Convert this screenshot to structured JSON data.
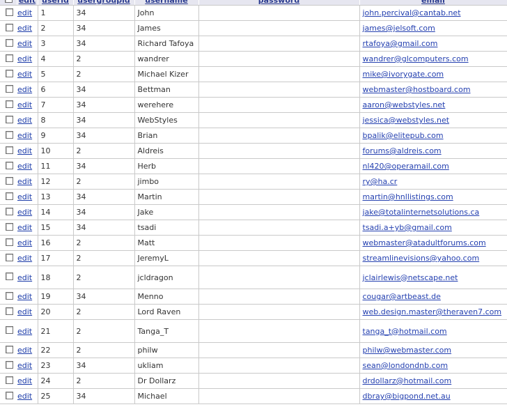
{
  "table": {
    "columns": {
      "edit": "edit",
      "userid": "userid",
      "usergroupid": "usergroupid",
      "username": "username",
      "password": "password",
      "email": "email"
    },
    "rows": [
      {
        "edit": "edit",
        "userid": "1",
        "usergroupid": "34",
        "username": "John",
        "password": "",
        "email": "john.percival@cantab.net"
      },
      {
        "edit": "edit",
        "userid": "2",
        "usergroupid": "34",
        "username": "James",
        "password": "",
        "email": "james@jelsoft.com"
      },
      {
        "edit": "edit",
        "userid": "3",
        "usergroupid": "34",
        "username": "Richard Tafoya",
        "password": "",
        "email": "rtafoya@gmail.com"
      },
      {
        "edit": "edit",
        "userid": "4",
        "usergroupid": "2",
        "username": "wandrer",
        "password": "",
        "email": "wandrer@glcomputers.com"
      },
      {
        "edit": "edit",
        "userid": "5",
        "usergroupid": "2",
        "username": "Michael Kizer",
        "password": "",
        "email": "mike@ivorygate.com"
      },
      {
        "edit": "edit",
        "userid": "6",
        "usergroupid": "34",
        "username": "Bettman",
        "password": "",
        "email": "webmaster@hostboard.com"
      },
      {
        "edit": "edit",
        "userid": "7",
        "usergroupid": "34",
        "username": "werehere",
        "password": "",
        "email": "aaron@webstyles.net"
      },
      {
        "edit": "edit",
        "userid": "8",
        "usergroupid": "34",
        "username": "WebStyles",
        "password": "",
        "email": "jessica@webstyles.net"
      },
      {
        "edit": "edit",
        "userid": "9",
        "usergroupid": "34",
        "username": "Brian",
        "password": "",
        "email": "bpalik@elitepub.com"
      },
      {
        "edit": "edit",
        "userid": "10",
        "usergroupid": "2",
        "username": "Aldreis",
        "password": "",
        "email": "forums@aldreis.com"
      },
      {
        "edit": "edit",
        "userid": "11",
        "usergroupid": "34",
        "username": "Herb",
        "password": "",
        "email": "nl420@operamail.com"
      },
      {
        "edit": "edit",
        "userid": "12",
        "usergroupid": "2",
        "username": "jimbo",
        "password": "",
        "email": "ry@ha.cr"
      },
      {
        "edit": "edit",
        "userid": "13",
        "usergroupid": "34",
        "username": "Martin",
        "password": "",
        "email": "martin@hnllistings.com"
      },
      {
        "edit": "edit",
        "userid": "14",
        "usergroupid": "34",
        "username": "Jake",
        "password": "",
        "email": "jake@totalinternetsolutions.ca"
      },
      {
        "edit": "edit",
        "userid": "15",
        "usergroupid": "34",
        "username": "tsadi",
        "password": "",
        "email": "tsadi.a+yb@gmail.com"
      },
      {
        "edit": "edit",
        "userid": "16",
        "usergroupid": "2",
        "username": "Matt",
        "password": "",
        "email": "webmaster@atadultforums.com"
      },
      {
        "edit": "edit",
        "userid": "17",
        "usergroupid": "2",
        "username": "JeremyL",
        "password": "",
        "email": "streamlinevisions@yahoo.com"
      },
      {
        "edit": "edit",
        "userid": "18",
        "usergroupid": "2",
        "username": "jcldragon",
        "password": "",
        "email": "jclairlewis@netscape.net"
      },
      {
        "edit": "edit",
        "userid": "19",
        "usergroupid": "34",
        "username": "Menno",
        "password": "",
        "email": "cougar@artbeast.de"
      },
      {
        "edit": "edit",
        "userid": "20",
        "usergroupid": "2",
        "username": "Lord Raven",
        "password": "",
        "email": "web.design.master@theraven7.com"
      },
      {
        "edit": "edit",
        "userid": "21",
        "usergroupid": "2",
        "username": "Tanga_T",
        "password": "",
        "email": "tanga_t@hotmail.com"
      },
      {
        "edit": "edit",
        "userid": "22",
        "usergroupid": "2",
        "username": "philw",
        "password": "",
        "email": "philw@webmaster.com"
      },
      {
        "edit": "edit",
        "userid": "23",
        "usergroupid": "34",
        "username": "ukliam",
        "password": "",
        "email": "sean@londondnb.com"
      },
      {
        "edit": "edit",
        "userid": "24",
        "usergroupid": "2",
        "username": "Dr Dollarz",
        "password": "",
        "email": "drdollarz@hotmail.com"
      },
      {
        "edit": "edit",
        "userid": "25",
        "usergroupid": "34",
        "username": "Michael",
        "password": "",
        "email": "dbray@bigpond.net.au"
      }
    ]
  }
}
